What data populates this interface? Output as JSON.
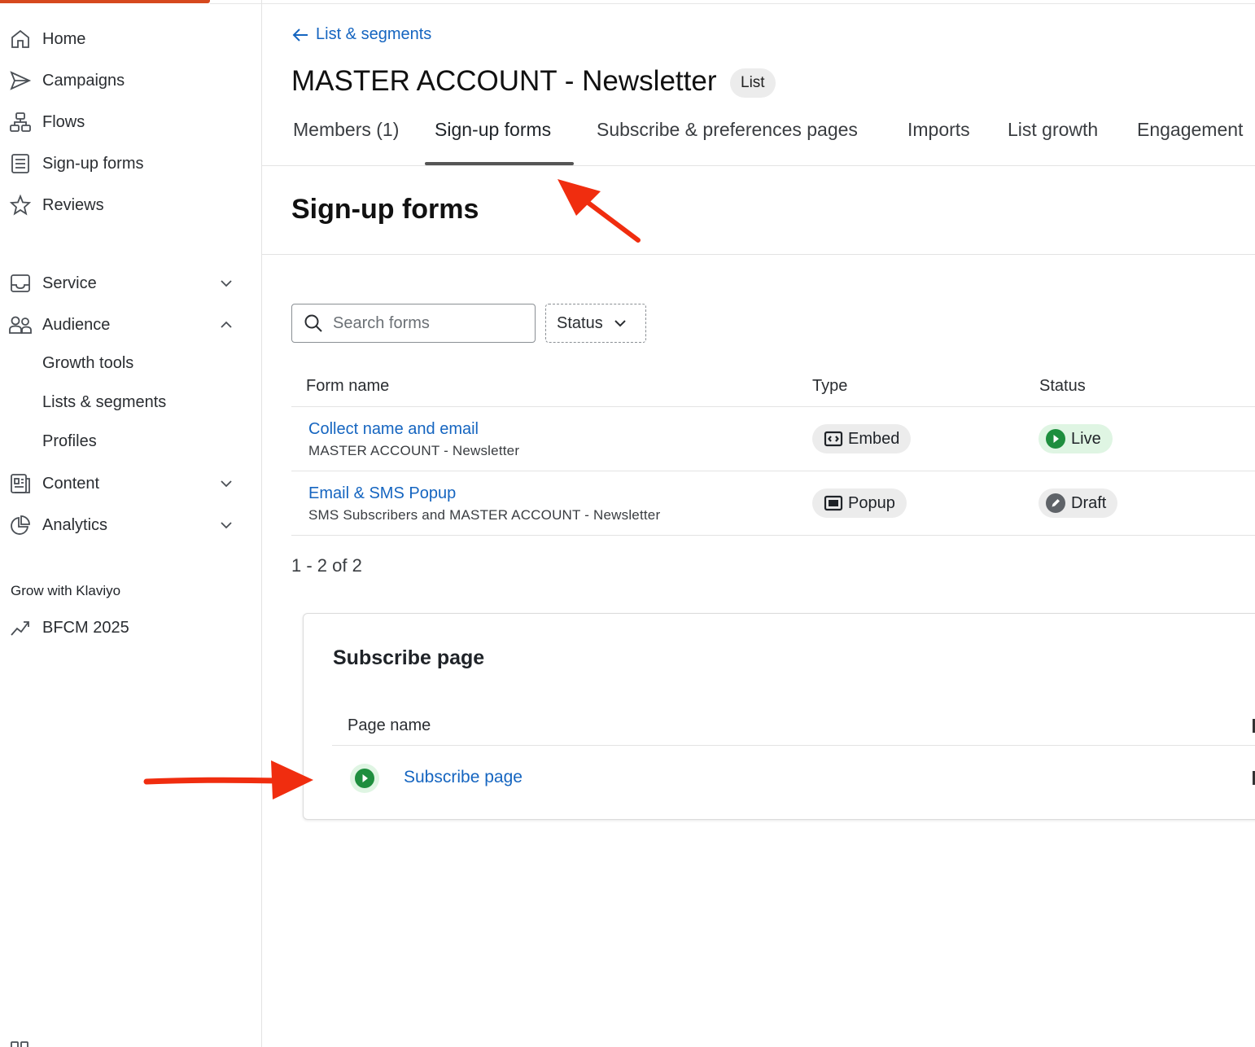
{
  "sidebar": {
    "items": [
      {
        "label": "Home",
        "icon": "home-icon"
      },
      {
        "label": "Campaigns",
        "icon": "send-icon"
      },
      {
        "label": "Flows",
        "icon": "flows-icon"
      },
      {
        "label": "Sign-up forms",
        "icon": "form-icon"
      },
      {
        "label": "Reviews",
        "icon": "star-icon"
      },
      {
        "label": "Service",
        "icon": "inbox-icon",
        "expandable": true,
        "expanded": false
      },
      {
        "label": "Audience",
        "icon": "people-icon",
        "expandable": true,
        "expanded": true
      },
      {
        "label": "Content",
        "icon": "content-icon",
        "expandable": true,
        "expanded": false
      },
      {
        "label": "Analytics",
        "icon": "pie-chart-icon",
        "expandable": true,
        "expanded": false
      }
    ],
    "audience_subitems": [
      "Growth tools",
      "Lists & segments",
      "Profiles"
    ],
    "grow_section_title": "Grow with Klaviyo",
    "grow_item": {
      "label": "BFCM 2025",
      "icon": "trending-up-icon"
    }
  },
  "header": {
    "back_link": "List & segments",
    "title": "MASTER ACCOUNT - Newsletter",
    "badge": "List"
  },
  "tabs": [
    {
      "label": "Members (1)",
      "active": false
    },
    {
      "label": "Sign-up forms",
      "active": true
    },
    {
      "label": "Subscribe & preferences pages",
      "active": false
    },
    {
      "label": "Imports",
      "active": false
    },
    {
      "label": "List growth",
      "active": false
    },
    {
      "label": "Engagement",
      "active": false
    }
  ],
  "forms_section": {
    "title": "Sign-up forms",
    "search_placeholder": "Search forms",
    "status_filter_label": "Status",
    "columns": [
      "Form name",
      "Type",
      "Status"
    ],
    "rows": [
      {
        "name": "Collect name and email",
        "list": "MASTER ACCOUNT - Newsletter",
        "type": "Embed",
        "type_icon": "embed-icon",
        "status": "Live",
        "status_icon": "play-icon"
      },
      {
        "name": "Email & SMS Popup",
        "list": "SMS Subscribers and MASTER ACCOUNT - Newsletter",
        "type": "Popup",
        "type_icon": "popup-icon",
        "status": "Draft",
        "status_icon": "pencil-icon"
      }
    ],
    "pagination": "1 - 2 of 2"
  },
  "subscribe_card": {
    "title": "Subscribe page",
    "column": "Page name",
    "row": {
      "name": "Subscribe page",
      "status_icon": "play-icon"
    }
  },
  "colors": {
    "accent": "#d6491e",
    "link": "#1565c0",
    "live_green": "#1e8e3e",
    "live_bg": "#dff5e3",
    "annotation_red": "#f02d0f"
  }
}
